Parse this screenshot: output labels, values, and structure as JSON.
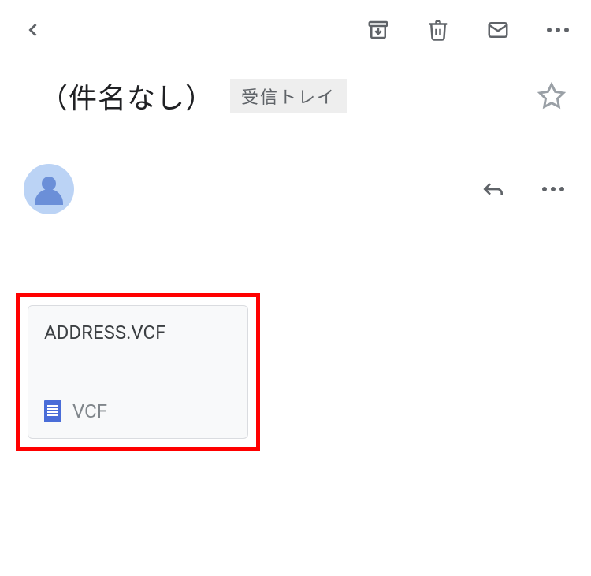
{
  "subject": "（件名なし）",
  "label": "受信トレイ",
  "attachment": {
    "name": "ADDRESS.VCF",
    "type": "VCF"
  }
}
